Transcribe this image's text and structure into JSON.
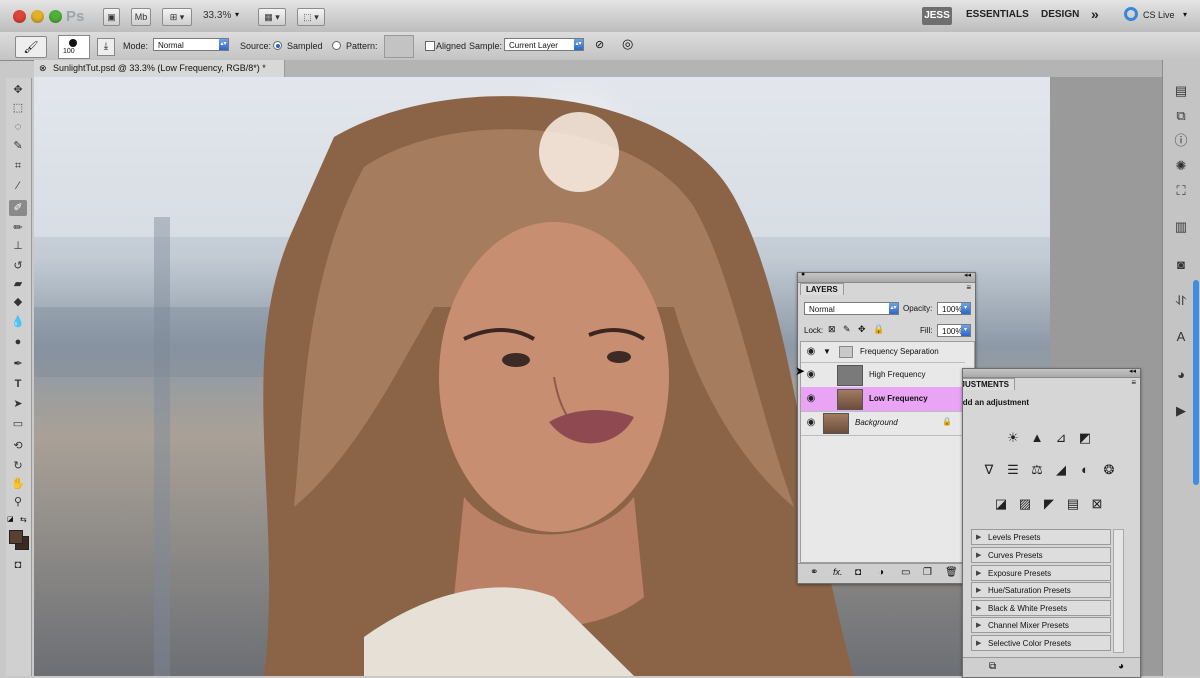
{
  "appbar": {
    "ps_logo": "Ps",
    "mb_label": "Mb",
    "zoom": "33.3%",
    "workspaces": [
      "JESS",
      "ESSENTIALS",
      "DESIGN"
    ],
    "overflow": "»",
    "cslive": "CS Live"
  },
  "options": {
    "brush_size": "100",
    "mode_label": "Mode:",
    "mode_value": "Normal",
    "source_label": "Source:",
    "sampled_label": "Sampled",
    "pattern_label": "Pattern:",
    "aligned_label": "Aligned",
    "sample_label": "Sample:",
    "sample_value": "Current Layer"
  },
  "document": {
    "tab_title": "SunlightTut.psd @ 33.3% (Low Frequency, RGB/8*) *"
  },
  "layers_panel": {
    "title": "LAYERS",
    "blend_mode": "Normal",
    "opacity_label": "Opacity:",
    "opacity_value": "100%",
    "lock_label": "Lock:",
    "fill_label": "Fill:",
    "fill_value": "100%",
    "layers": [
      {
        "name": "Frequency Separation",
        "type": "group"
      },
      {
        "name": "High Frequency",
        "type": "layer"
      },
      {
        "name": "Low Frequency",
        "type": "layer",
        "selected": true
      },
      {
        "name": "Background",
        "type": "background"
      }
    ]
  },
  "adjustments_panel": {
    "title": "ADJUSTMENTS",
    "subtitle": "Add an adjustment",
    "presets": [
      "Levels Presets",
      "Curves Presets",
      "Exposure Presets",
      "Hue/Saturation Presets",
      "Black & White Presets",
      "Channel Mixer Presets",
      "Selective Color Presets"
    ]
  },
  "colors": {
    "selected_layer": "#e9a4f5",
    "foreground": "#5a3f33",
    "background": "#3b2a22"
  }
}
